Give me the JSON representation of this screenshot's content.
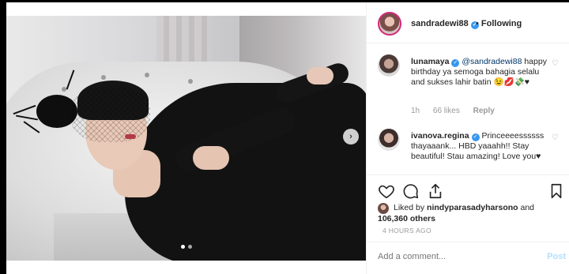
{
  "header": {
    "username": "sandradewi88",
    "separator": "•",
    "follow_status": "Following"
  },
  "comments": [
    {
      "username": "lunamaya",
      "mention": "@sandradewi88",
      "text": "happy birthday ya semoga bahagia selalu and sukses lahir batin 😉💋💸♥",
      "time": "1h",
      "likes": "66 likes",
      "reply": "Reply"
    },
    {
      "username": "ivanova.regina",
      "text": "Princeeeessssss thayaaank... HBD yaaahh!! Stay beautiful! Stau amazing! Love you♥"
    }
  ],
  "likes": {
    "prefix": "Liked by",
    "by_user": "nindyparasadyharsono",
    "joiner": "and",
    "others": "106,360 others"
  },
  "timestamp": "4 HOURS AGO",
  "add_comment": {
    "placeholder": "Add a comment...",
    "post_label": "Post"
  },
  "icons": {
    "next": "chevron-right-icon",
    "like": "heart-icon",
    "comment": "comment-icon",
    "share": "share-icon",
    "save": "bookmark-icon"
  },
  "colors": {
    "verified": "#3897f0",
    "mention": "#003569",
    "post_disabled": "#b2dffc",
    "story_ring": "#d0297a"
  },
  "carousel": {
    "slide_count": 2,
    "active_index": 1
  }
}
